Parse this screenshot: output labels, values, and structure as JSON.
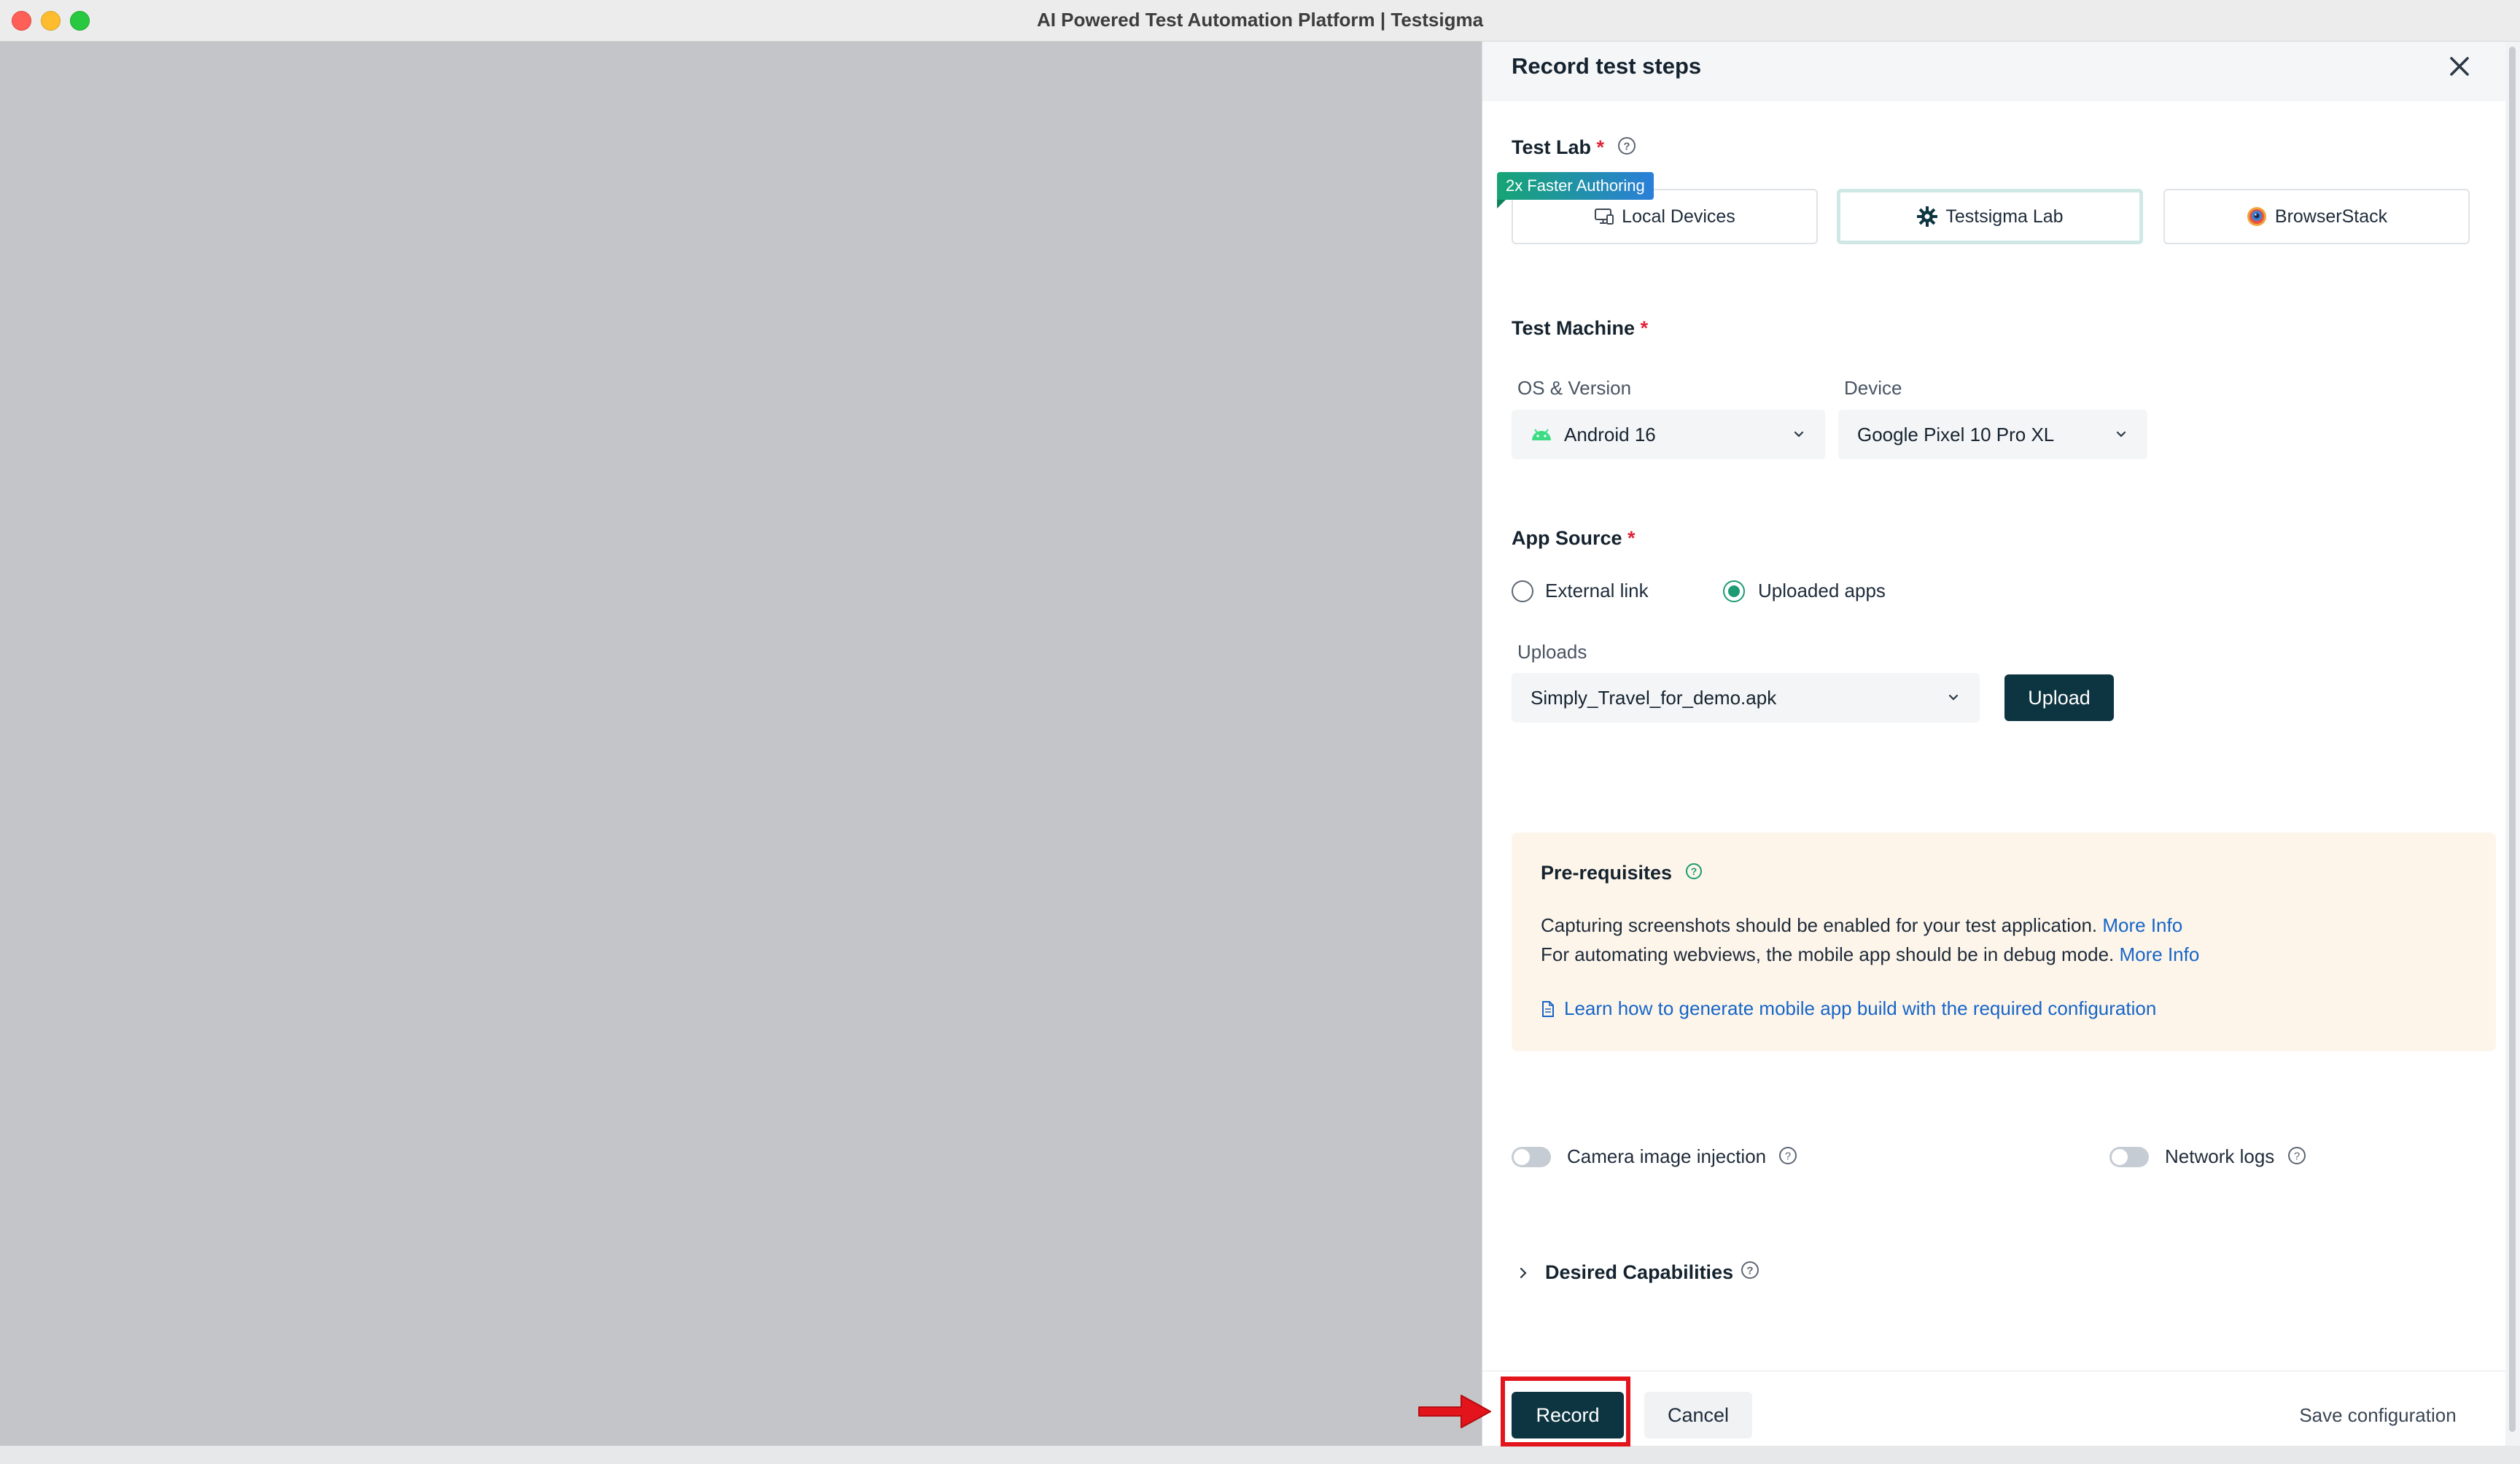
{
  "window": {
    "title": "AI Powered Test Automation Platform | Testsigma"
  },
  "panel": {
    "title": "Record test steps",
    "test_lab": {
      "label": "Test Lab",
      "required": "*",
      "badge": "2x Faster Authoring",
      "options": [
        "Local Devices",
        "Testsigma Lab",
        "BrowserStack"
      ],
      "selected": "Testsigma Lab"
    },
    "test_machine": {
      "label": "Test Machine",
      "required": "*",
      "os_label": "OS & Version",
      "os_value": "Android 16",
      "device_label": "Device",
      "device_value": "Google Pixel 10 Pro XL"
    },
    "app_source": {
      "label": "App Source",
      "required": "*",
      "options": [
        "External link",
        "Uploaded apps"
      ],
      "selected": "Uploaded apps",
      "uploads_label": "Uploads",
      "uploads_value": "Simply_Travel_for_demo.apk",
      "upload_button": "Upload"
    },
    "prerequisites": {
      "title": "Pre-requisites",
      "line1": "Capturing screenshots should be enabled for your test application.",
      "line1_link": "More Info",
      "line2": "For automating webviews, the mobile app should be in debug mode.",
      "line2_link": "More Info",
      "doc_link": "Learn how to generate mobile app build with the required configuration"
    },
    "toggles": {
      "camera": "Camera image injection",
      "network": "Network logs"
    },
    "desired_capabilities": "Desired Capabilities",
    "footer": {
      "record": "Record",
      "cancel": "Cancel",
      "save": "Save configuration"
    }
  },
  "colors": {
    "primary_dark": "#0d3541",
    "accent_green": "#1d9b72",
    "link_blue": "#1665c8",
    "annotation_red": "#e3141b"
  },
  "icons": [
    "close-icon",
    "help-icon",
    "monitor-icon",
    "gear-icon",
    "browserstack-icon",
    "android-icon",
    "chevron-down-icon",
    "document-icon",
    "chevron-right-icon",
    "arrow-icon"
  ]
}
